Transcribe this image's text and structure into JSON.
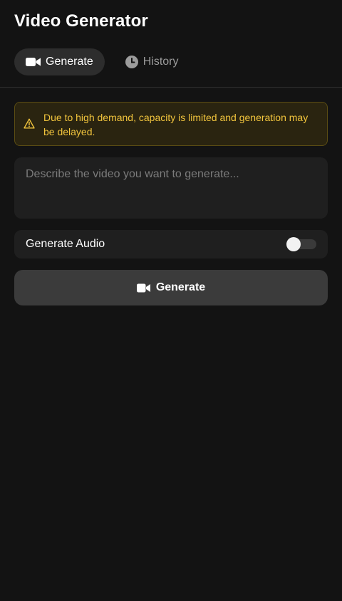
{
  "header": {
    "title": "Video Generator"
  },
  "tabs": [
    {
      "label": "Generate",
      "icon": "video-camera-icon",
      "active": true
    },
    {
      "label": "History",
      "icon": "clock-icon",
      "active": false
    }
  ],
  "banner": {
    "icon": "warning-triangle-icon",
    "text": "Due to high demand, capacity is limited and generation may be delayed.",
    "color": "#f2c53d"
  },
  "prompt": {
    "placeholder": "Describe the video you want to generate...",
    "value": ""
  },
  "audio": {
    "label": "Generate Audio",
    "enabled": false
  },
  "generate_button": {
    "label": "Generate",
    "icon": "video-camera-icon"
  }
}
